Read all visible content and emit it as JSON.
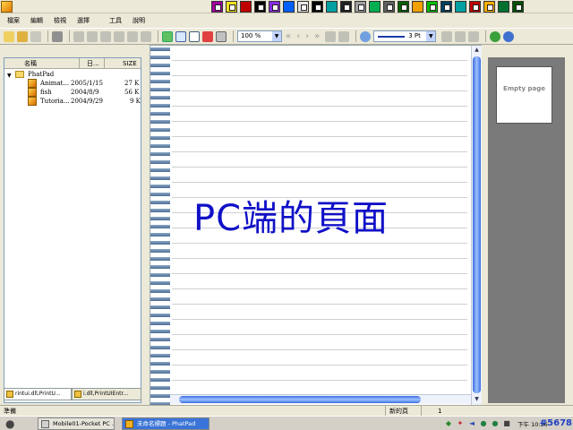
{
  "menubar": {
    "items": [
      "檔案",
      "編輯",
      "檢視",
      "選擇",
      "工具",
      "說明"
    ]
  },
  "swatches": [
    "#a000a0",
    "#f0e020",
    "#c00000",
    "#000000",
    "#8a2be2",
    "#0060ff",
    "#e6e6e6",
    "#000000",
    "#00a0a0",
    "#202020",
    "#a0a0a0",
    "#00b050",
    "#606060",
    "#006000",
    "#f0a000",
    "#00c000",
    "#004060",
    "#00a0a0",
    "#c00000",
    "#ffb000",
    "#007030",
    "#005000"
  ],
  "toolbar": {
    "zoom_value": "100 %",
    "pen_size": "3 Pt"
  },
  "file_pane": {
    "headers": {
      "name": "名稱",
      "date": "日...",
      "size": "SIZE"
    },
    "folder": "PhatPad",
    "files": [
      {
        "name": "Animat...",
        "date": "2005/1/15",
        "size": "27 K"
      },
      {
        "name": "fish",
        "date": "2004/8/9",
        "size": "56 K"
      },
      {
        "name": "Tutoria...",
        "date": "2004/9/29",
        "size": "9 K"
      }
    ],
    "tabs": [
      "rintui.dll,PrintU...",
      "i.dll,PrintUIEntr..."
    ]
  },
  "page": {
    "text": "PC端的頁面"
  },
  "thumbnail": {
    "label": "Empty page"
  },
  "status": {
    "left": "準備",
    "new_page": "新的頁",
    "page_number": "1"
  },
  "taskbar": {
    "tasks": [
      "Mobile01-Pocket PC ...",
      "未命名標題 - PhatPad"
    ],
    "clock": "下午 10:36",
    "watermark": "#5678"
  },
  "colors": {
    "ink": "#1010c8",
    "accent": "#3b74d8"
  }
}
